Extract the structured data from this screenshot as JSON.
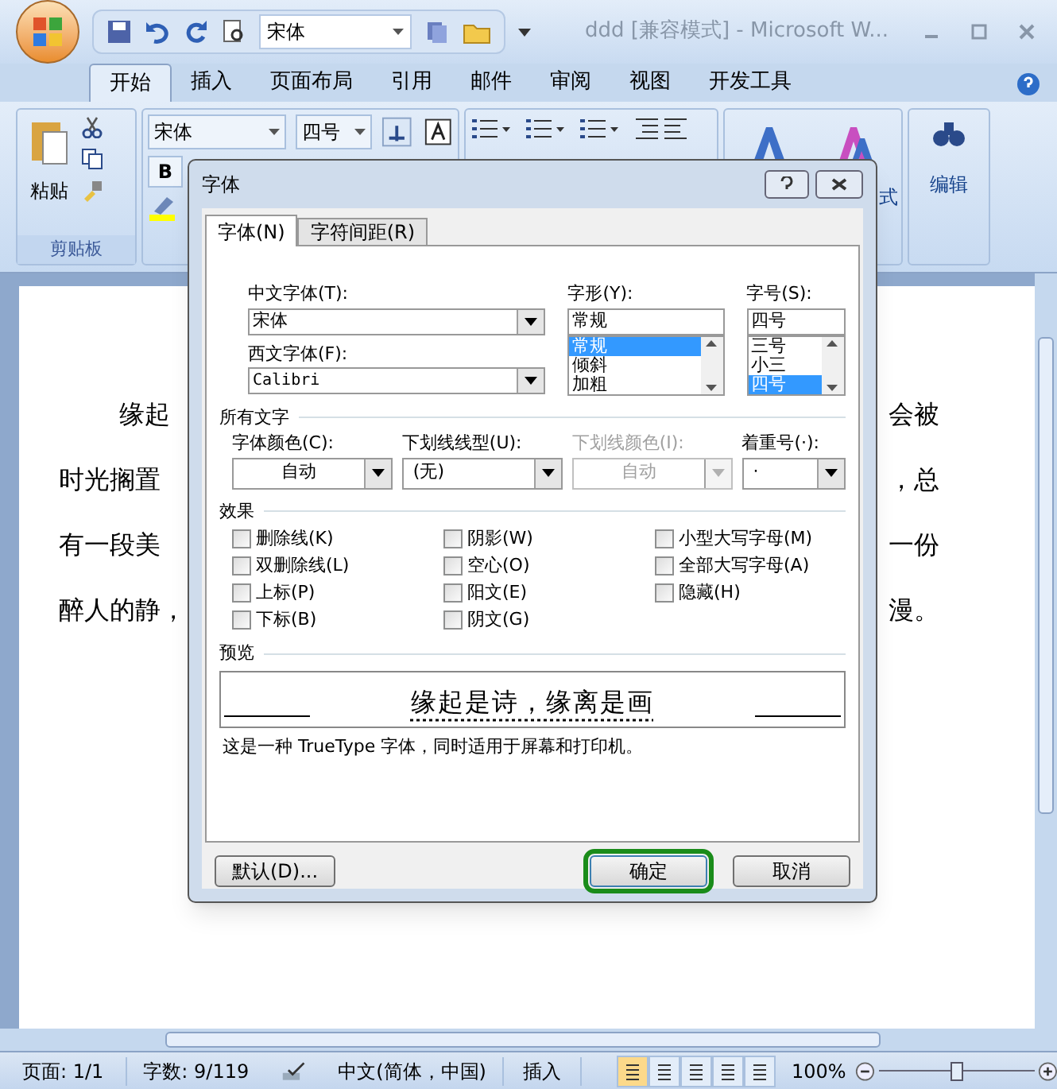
{
  "quick_access": {
    "font": "宋体"
  },
  "window": {
    "title": "ddd [兼容模式] - Microsoft W..."
  },
  "ribbon_tabs": [
    {
      "label": "开始",
      "selected": true
    },
    {
      "label": "插入",
      "selected": false
    },
    {
      "label": "页面布局",
      "selected": false
    },
    {
      "label": "引用",
      "selected": false
    },
    {
      "label": "邮件",
      "selected": false
    },
    {
      "label": "审阅",
      "selected": false
    },
    {
      "label": "视图",
      "selected": false
    },
    {
      "label": "开发工具",
      "selected": false
    }
  ],
  "ribbon": {
    "paste": "粘贴",
    "clipboard_group": "剪贴板",
    "font_name": "宋体",
    "font_size": "四号",
    "bold": "B",
    "styles": "式",
    "editing": "编辑"
  },
  "document": {
    "lines": [
      {
        "left": "缘起",
        "right": "会被",
        "indent": true
      },
      {
        "left": "时光搁置",
        "right": "，总",
        "indent": false
      },
      {
        "left": "有一段美",
        "right": "一份",
        "indent": false
      },
      {
        "left": "醉人的静，",
        "right": "漫。",
        "indent": false
      }
    ]
  },
  "dialog": {
    "title": "字体",
    "tabs": [
      {
        "label": "字体(N)",
        "selected": true
      },
      {
        "label": "字符间距(R)",
        "selected": false
      }
    ],
    "chinese_font": {
      "label": "中文字体(T):",
      "value": "宋体"
    },
    "western_font": {
      "label": "西文字体(F):",
      "value": "Calibri"
    },
    "style": {
      "label": "字形(Y):",
      "value": "常规",
      "items": [
        {
          "label": "常规",
          "selected": true
        },
        {
          "label": "倾斜",
          "selected": false
        },
        {
          "label": "加粗",
          "selected": false
        }
      ]
    },
    "size": {
      "label": "字号(S):",
      "value": "四号",
      "items": [
        {
          "label": "三号",
          "selected": false
        },
        {
          "label": "小三",
          "selected": false
        },
        {
          "label": "四号",
          "selected": true
        }
      ]
    },
    "all_text": {
      "heading": "所有文字",
      "fields": [
        {
          "label": "字体颜色(C):",
          "value": "自动",
          "disabled": false
        },
        {
          "label": "下划线线型(U):",
          "value": "(无)",
          "disabled": false
        },
        {
          "label": "下划线颜色(I):",
          "value": "自动",
          "disabled": true
        },
        {
          "label": "着重号(·):",
          "value": "·",
          "disabled": false
        }
      ]
    },
    "effects": {
      "heading": "效果",
      "columns": [
        [
          {
            "label": "删除线(K)",
            "checked": false
          },
          {
            "label": "双删除线(L)",
            "checked": false
          },
          {
            "label": "上标(P)",
            "checked": false
          },
          {
            "label": "下标(B)",
            "checked": false
          }
        ],
        [
          {
            "label": "阴影(W)",
            "checked": false
          },
          {
            "label": "空心(O)",
            "checked": false
          },
          {
            "label": "阳文(E)",
            "checked": false
          },
          {
            "label": "阴文(G)",
            "checked": false
          }
        ],
        [
          {
            "label": "小型大写字母(M)",
            "checked": false
          },
          {
            "label": "全部大写字母(A)",
            "checked": false
          },
          {
            "label": "隐藏(H)",
            "checked": false
          }
        ]
      ]
    },
    "preview": {
      "heading": "预览",
      "sample": "缘起是诗，缘离是画",
      "note": "这是一种 TrueType 字体，同时适用于屏幕和打印机。"
    },
    "buttons": [
      {
        "label": "默认(D)...",
        "highlighted": false
      },
      {
        "label": "确定",
        "highlighted": true
      },
      {
        "label": "取消",
        "highlighted": false
      }
    ]
  },
  "status_bar": {
    "page": "页面: 1/1",
    "words": "字数: 9/119",
    "language": "中文(简体，中国)",
    "mode": "插入",
    "views": [
      {
        "selected": true
      },
      {
        "selected": false
      },
      {
        "selected": false
      },
      {
        "selected": false
      },
      {
        "selected": false
      }
    ],
    "zoom": "100%",
    "zoom_slider": {
      "level": 0.5
    }
  }
}
